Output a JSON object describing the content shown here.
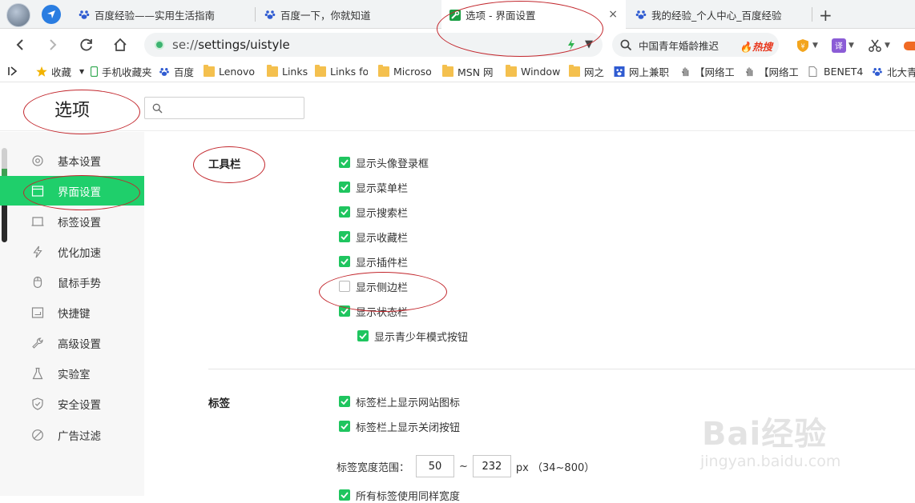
{
  "browser": {
    "tabs": [
      {
        "label": "百度经验——实用生活指南"
      },
      {
        "label": "百度一下，你就知道"
      },
      {
        "label": "选项 - 界面设置",
        "close": "×"
      },
      {
        "label": "我的经验_个人中心_百度经验"
      }
    ],
    "new_tab": "+",
    "url_scheme": "se://",
    "url_path": "settings/uistyle",
    "search_query": "中国青年婚龄推迟",
    "search_hot": "热搜",
    "bookmarks": [
      "收藏",
      "手机收藏夹",
      "百度",
      "Lenovo",
      "Links",
      "Links fo",
      "Microso",
      "MSN 网",
      "Window",
      "网之",
      "网上兼职",
      "【网络工",
      "【网络工",
      "BENET4",
      "北大青"
    ]
  },
  "settings": {
    "title": "选项",
    "search_placeholder": "",
    "nav": [
      {
        "label": "基本设置",
        "icon": "gear-icon"
      },
      {
        "label": "界面设置",
        "icon": "window-icon"
      },
      {
        "label": "标签设置",
        "icon": "tab-icon"
      },
      {
        "label": "优化加速",
        "icon": "lightning-icon"
      },
      {
        "label": "鼠标手势",
        "icon": "mouse-icon"
      },
      {
        "label": "快捷键",
        "icon": "keyboard-icon"
      },
      {
        "label": "高级设置",
        "icon": "wrench-icon"
      },
      {
        "label": "实验室",
        "icon": "flask-icon"
      },
      {
        "label": "安全设置",
        "icon": "shield-icon"
      },
      {
        "label": "广告过滤",
        "icon": "block-icon"
      }
    ],
    "toolbar_section": {
      "title": "工具栏",
      "options": [
        {
          "label": "显示头像登录框",
          "checked": true
        },
        {
          "label": "显示菜单栏",
          "checked": true
        },
        {
          "label": "显示搜索栏",
          "checked": true
        },
        {
          "label": "显示收藏栏",
          "checked": true
        },
        {
          "label": "显示插件栏",
          "checked": true
        },
        {
          "label": "显示侧边栏",
          "checked": false
        },
        {
          "label": "显示状态栏",
          "checked": true
        },
        {
          "label": "显示青少年模式按钮",
          "checked": true
        }
      ]
    },
    "tab_section": {
      "title": "标签",
      "options": [
        {
          "label": "标签栏上显示网站图标",
          "checked": true
        },
        {
          "label": "标签栏上显示关闭按钮",
          "checked": true
        },
        {
          "label": "所有标签使用同样宽度",
          "checked": true
        }
      ],
      "width_range_label": "标签宽度范围：",
      "width_min": "50",
      "width_sep": "~",
      "width_max": "232",
      "width_unit": "px （34~800）"
    }
  },
  "watermark": {
    "logo": "Bai经验",
    "sub": "jingyan.baidu.com"
  },
  "colors": {
    "accent": "#1fcf6b",
    "annotation": "#c2262c"
  }
}
